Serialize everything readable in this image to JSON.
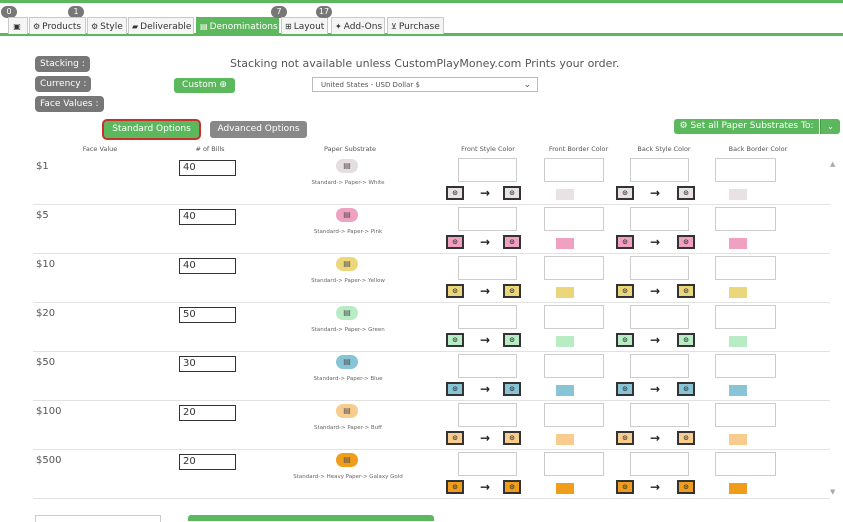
{
  "tabs": [
    {
      "label": "",
      "icon": "image-icon",
      "badge": "0"
    },
    {
      "label": "Products",
      "icon": "gear-icon",
      "badge": "1"
    },
    {
      "label": "Style",
      "icon": "gears-icon",
      "badge": null
    },
    {
      "label": "Deliverable",
      "icon": "truck-icon",
      "badge": null
    },
    {
      "label": "Denominations",
      "icon": "money-icon",
      "badge": null,
      "active": true
    },
    {
      "label": "Layout",
      "icon": "layout-icon",
      "badge": "7"
    },
    {
      "label": "Add-Ons",
      "icon": "plugin-icon",
      "badge": "17"
    },
    {
      "label": "Purchase",
      "icon": "cart-icon",
      "badge": null
    }
  ],
  "settings": {
    "stacking_label": "Stacking :",
    "stacking_message": "Stacking not available unless CustomPlayMoney.com Prints your order.",
    "currency_label": "Currency :",
    "custom_button": "Custom",
    "currency_selected": "United States - USD Dollar $",
    "face_values_label": "Face Values :"
  },
  "options": {
    "standard": "Standard Options",
    "advanced": "Advanced Options",
    "set_all": "Set all Paper Substrates To:"
  },
  "columns": [
    "Face Value",
    "# of Bills",
    "Paper Substrate",
    "Front Style Color",
    "Front Border Color",
    "Back Style Color",
    "Back Border Color"
  ],
  "rows": [
    {
      "face_value": "$1",
      "bills": "40",
      "paper": "Standard-> Paper-> White",
      "color": "#e8e2e4",
      "paper_icon_color": "#e6dde0"
    },
    {
      "face_value": "$5",
      "bills": "40",
      "paper": "Standard-> Paper-> Pink",
      "color": "#f0a0c0",
      "paper_icon_color": "#f0a0c0"
    },
    {
      "face_value": "$10",
      "bills": "40",
      "paper": "Standard-> Paper-> Yellow",
      "color": "#ecd67a",
      "paper_icon_color": "#ecd67a"
    },
    {
      "face_value": "$20",
      "bills": "50",
      "paper": "Standard-> Paper-> Green",
      "color": "#b8ecc4",
      "paper_icon_color": "#b8ecc4"
    },
    {
      "face_value": "$50",
      "bills": "30",
      "paper": "Standard-> Paper-> Blue",
      "color": "#86c4d6",
      "paper_icon_color": "#86c4d6"
    },
    {
      "face_value": "$100",
      "bills": "20",
      "paper": "Standard-> Paper-> Buff",
      "color": "#f8cc8e",
      "paper_icon_color": "#f8cc8e"
    },
    {
      "face_value": "$500",
      "bills": "20",
      "paper": "Standard-> Heavy Paper-> Galaxy Gold",
      "color": "#ef9d1a",
      "paper_icon_color": "#ef9d1a"
    }
  ]
}
